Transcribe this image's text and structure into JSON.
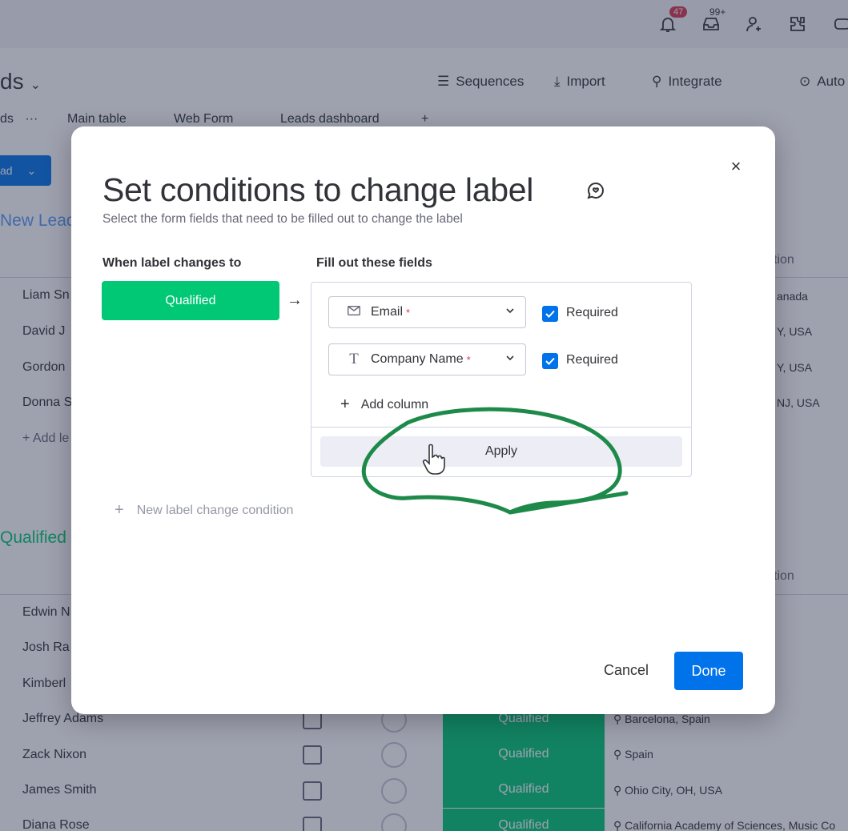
{
  "app": {
    "board_title": "ds",
    "notifications_badge": "47",
    "inbox_badge": "99+",
    "actions": {
      "sequences": "Sequences",
      "import": "Import",
      "integrate": "Integrate",
      "automate": "Auto"
    },
    "tabs": {
      "current_partial": "ds",
      "more": "···",
      "main_table": "Main table",
      "web_form": "Web Form",
      "leads_dashboard": "Leads dashboard",
      "add": "+"
    },
    "new_button_label": "ad",
    "groups": [
      {
        "title": "New Lead",
        "rows": [
          {
            "name": "Liam Sn",
            "location": "anada"
          },
          {
            "name": "David J",
            "location": "Y, USA"
          },
          {
            "name": "Gordon",
            "location": "Y, USA"
          },
          {
            "name": "Donna S",
            "location": "NJ, USA"
          }
        ],
        "add_item": "+ Add le",
        "column_label": "tion"
      },
      {
        "title": "Qualified",
        "rows": [
          {
            "name": "Edwin N",
            "status": "",
            "location": ""
          },
          {
            "name": "Josh Ra",
            "status": "",
            "location": ""
          },
          {
            "name": "Kimberl",
            "status": "",
            "location": ""
          },
          {
            "name": "Jeffrey Adams",
            "status": "Qualified",
            "location": "Barcelona, Spain"
          },
          {
            "name": "Zack Nixon",
            "status": "Qualified",
            "location": "Spain"
          },
          {
            "name": "James Smith",
            "status": "Qualified",
            "location": "Ohio City, OH, USA"
          },
          {
            "name": "Diana Rose",
            "status": "Qualified",
            "location": "California Academy of Sciences, Music Co"
          }
        ],
        "column_label": "tion"
      }
    ]
  },
  "modal": {
    "title": "Set conditions to change label",
    "subtitle": "Select the form fields that need to be filled out to change the label",
    "when_label_heading": "When label changes to",
    "fill_fields_heading": "Fill out these fields",
    "label_value": "Qualified",
    "fields": [
      {
        "icon": "mail-icon",
        "name": "Email",
        "required_marker": "*",
        "required_checked": true,
        "required_label": "Required"
      },
      {
        "icon": "text-icon",
        "name": "Company Name",
        "required_marker": "*",
        "required_checked": true,
        "required_label": "Required"
      }
    ],
    "add_column": "Add column",
    "apply": "Apply",
    "new_condition": "New label change condition",
    "cancel": "Cancel",
    "done": "Done",
    "close_symbol": "×"
  },
  "colors": {
    "status_green": "#00c875",
    "primary_blue": "#0073ea",
    "annotation_green": "#1e8a4a",
    "required_red": "#d83a52"
  }
}
